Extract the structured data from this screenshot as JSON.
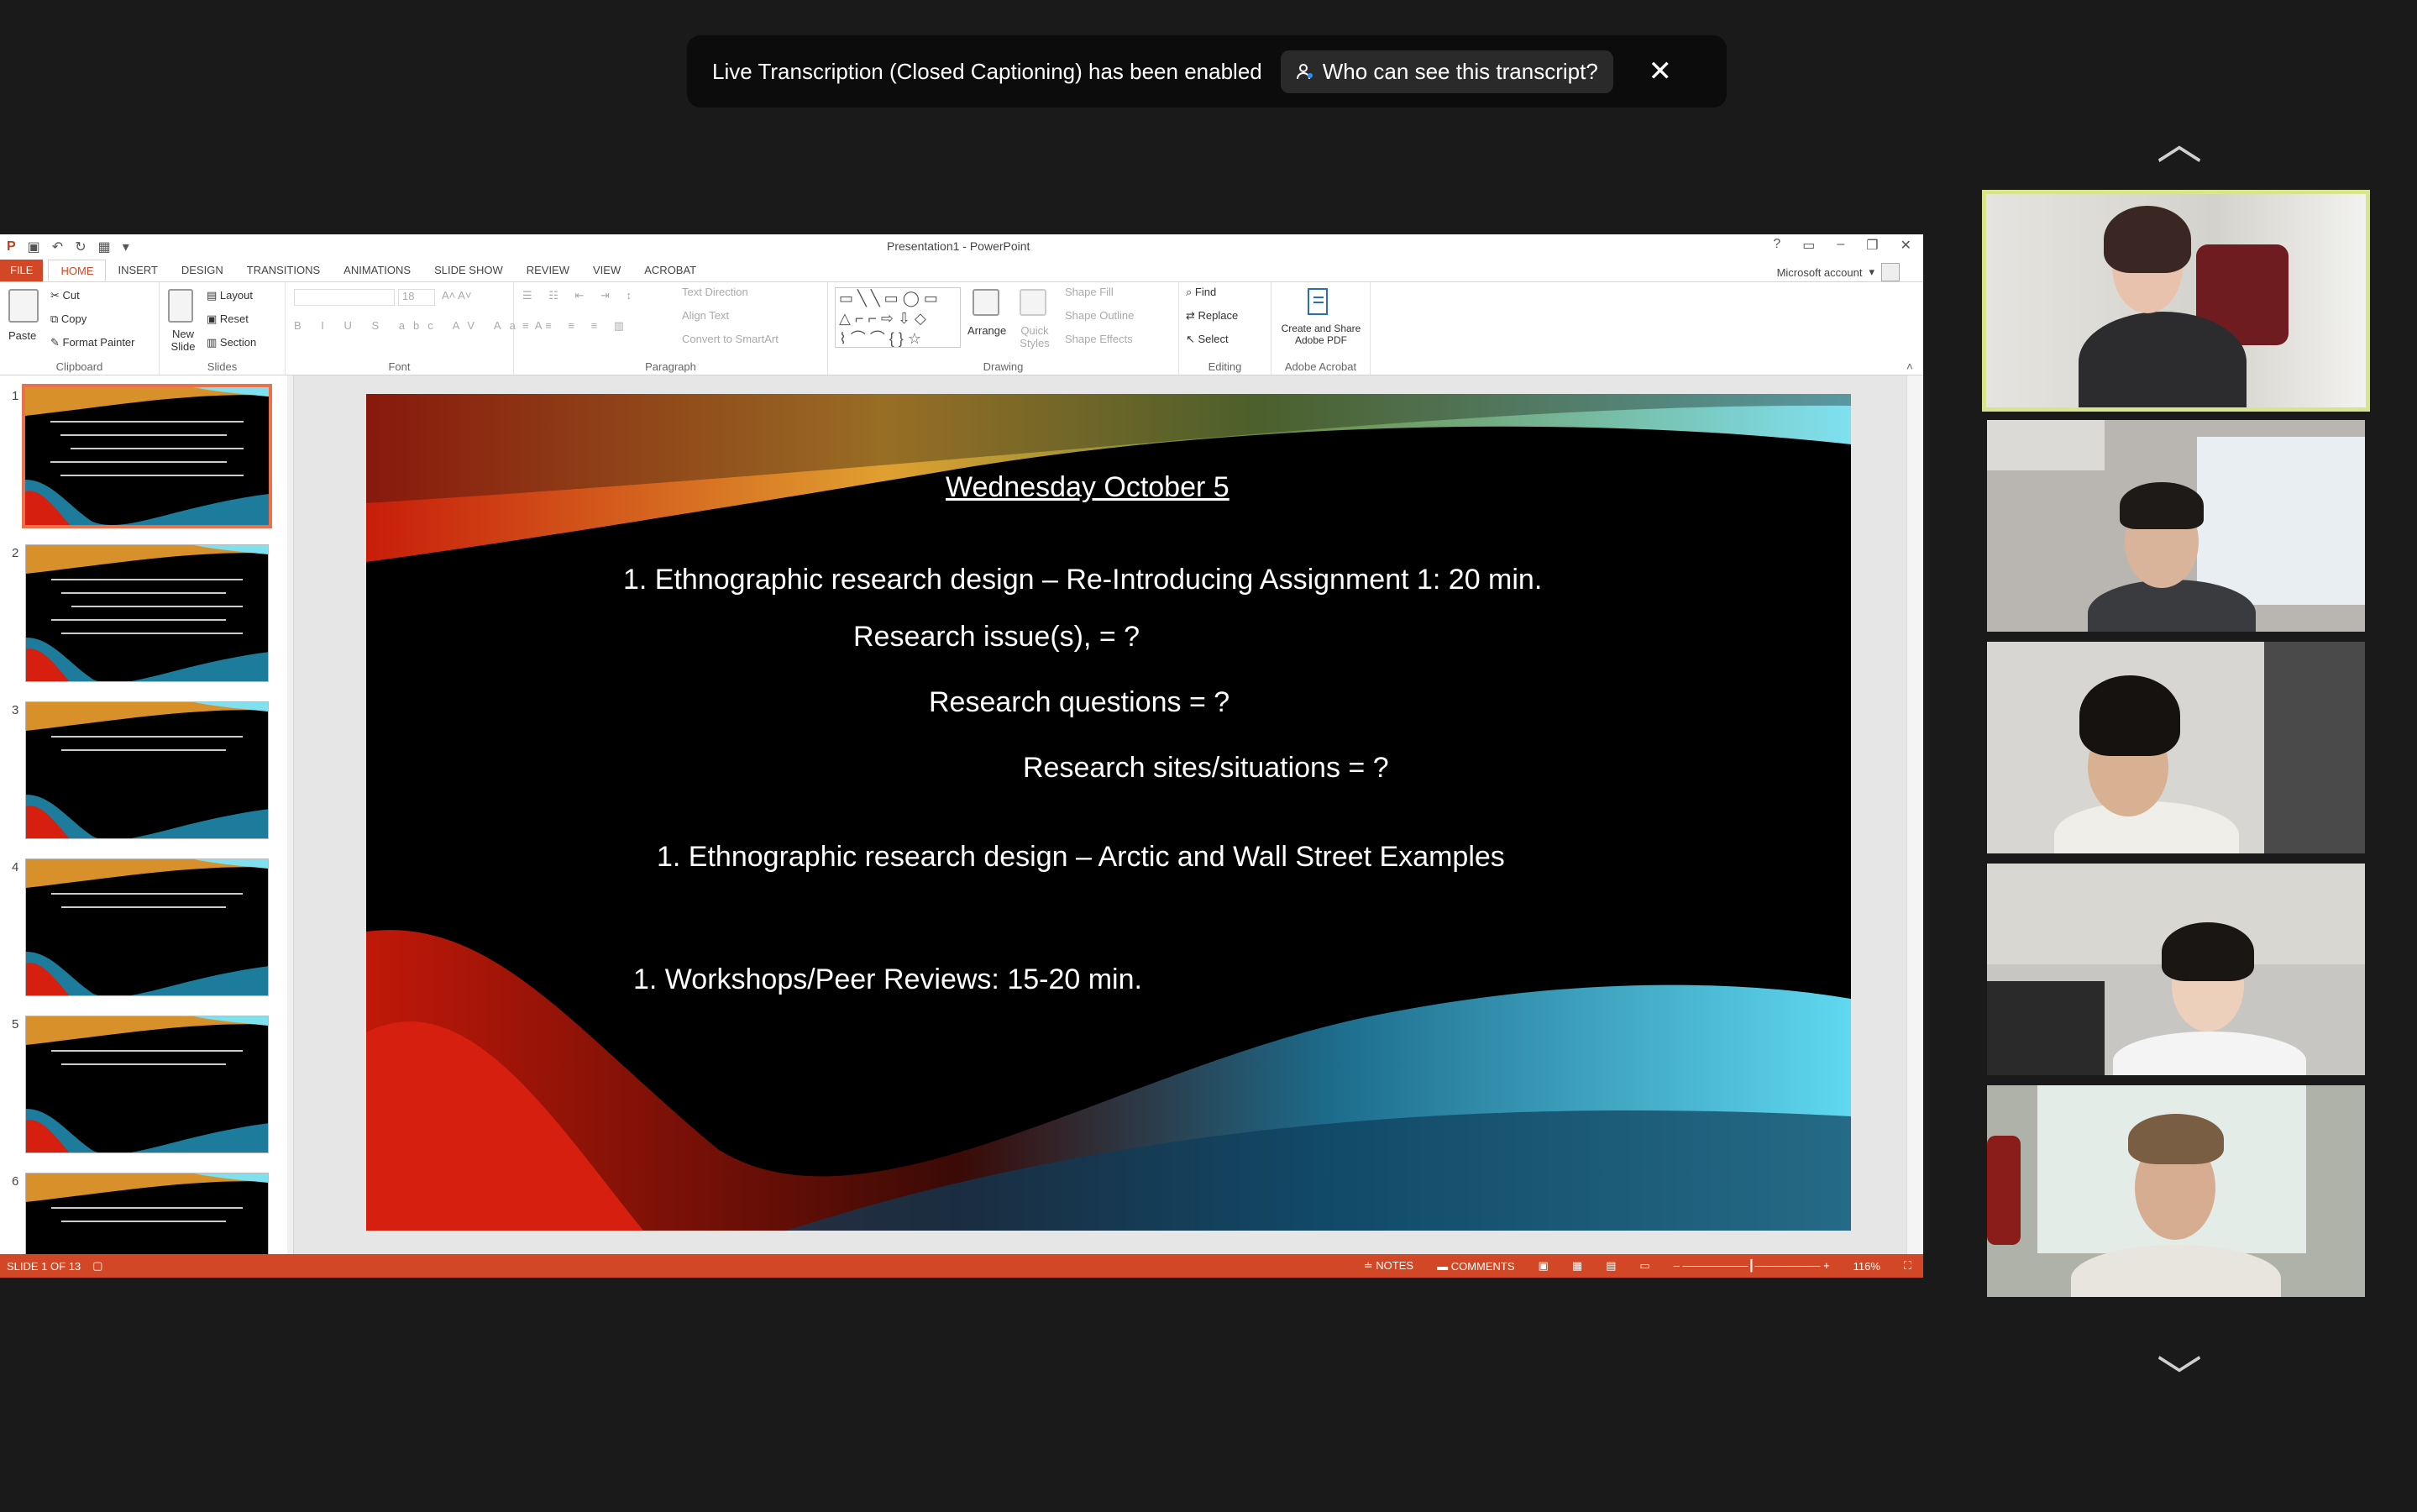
{
  "banner": {
    "message": "Live Transcription (Closed Captioning) has been enabled",
    "button_label": "Who can see this transcript?",
    "close_icon": "✕"
  },
  "window": {
    "title": "Presentation1 - PowerPoint",
    "account": "Microsoft account"
  },
  "tabs": [
    "FILE",
    "HOME",
    "INSERT",
    "DESIGN",
    "TRANSITIONS",
    "ANIMATIONS",
    "SLIDE SHOW",
    "REVIEW",
    "VIEW",
    "ACROBAT"
  ],
  "ribbon": {
    "clipboard": {
      "label": "Clipboard",
      "paste": "Paste",
      "cut": "Cut",
      "copy": "Copy",
      "format_painter": "Format Painter"
    },
    "slides": {
      "label": "Slides",
      "new_slide": "New Slide",
      "layout": "Layout",
      "reset": "Reset",
      "section": "Section"
    },
    "font": {
      "label": "Font",
      "size": "18"
    },
    "paragraph": {
      "label": "Paragraph",
      "text_direction": "Text Direction",
      "align_text": "Align Text",
      "convert_smartart": "Convert to SmartArt"
    },
    "drawing": {
      "label": "Drawing",
      "arrange": "Arrange",
      "quick_styles": "Quick Styles",
      "shape_fill": "Shape Fill",
      "shape_outline": "Shape Outline",
      "shape_effects": "Shape Effects"
    },
    "editing": {
      "label": "Editing",
      "find": "Find",
      "replace": "Replace",
      "select": "Select"
    },
    "acrobat": {
      "label": "Adobe Acrobat",
      "create_share": "Create and Share Adobe PDF"
    }
  },
  "thumbnails": [
    "1",
    "2",
    "3",
    "4",
    "5",
    "6"
  ],
  "slide": {
    "title": "Wednesday October 5",
    "line1": "1. Ethnographic research design – Re-Introducing Assignment 1: 20 min.",
    "line2": "Research issue(s), = ?",
    "line3": "Research questions = ?",
    "line4": "Research sites/situations = ?",
    "line5": "1. Ethnographic research design – Arctic and Wall Street Examples",
    "line6": "1. Workshops/Peer Reviews: 15-20 min."
  },
  "status": {
    "slide_info": "SLIDE 1 OF 13",
    "notes": "NOTES",
    "comments": "COMMENTS",
    "zoom": "116%"
  },
  "participants": {
    "scroll_up_icon": "chevron-up",
    "scroll_down_icon": "chevron-down",
    "count": 5
  }
}
